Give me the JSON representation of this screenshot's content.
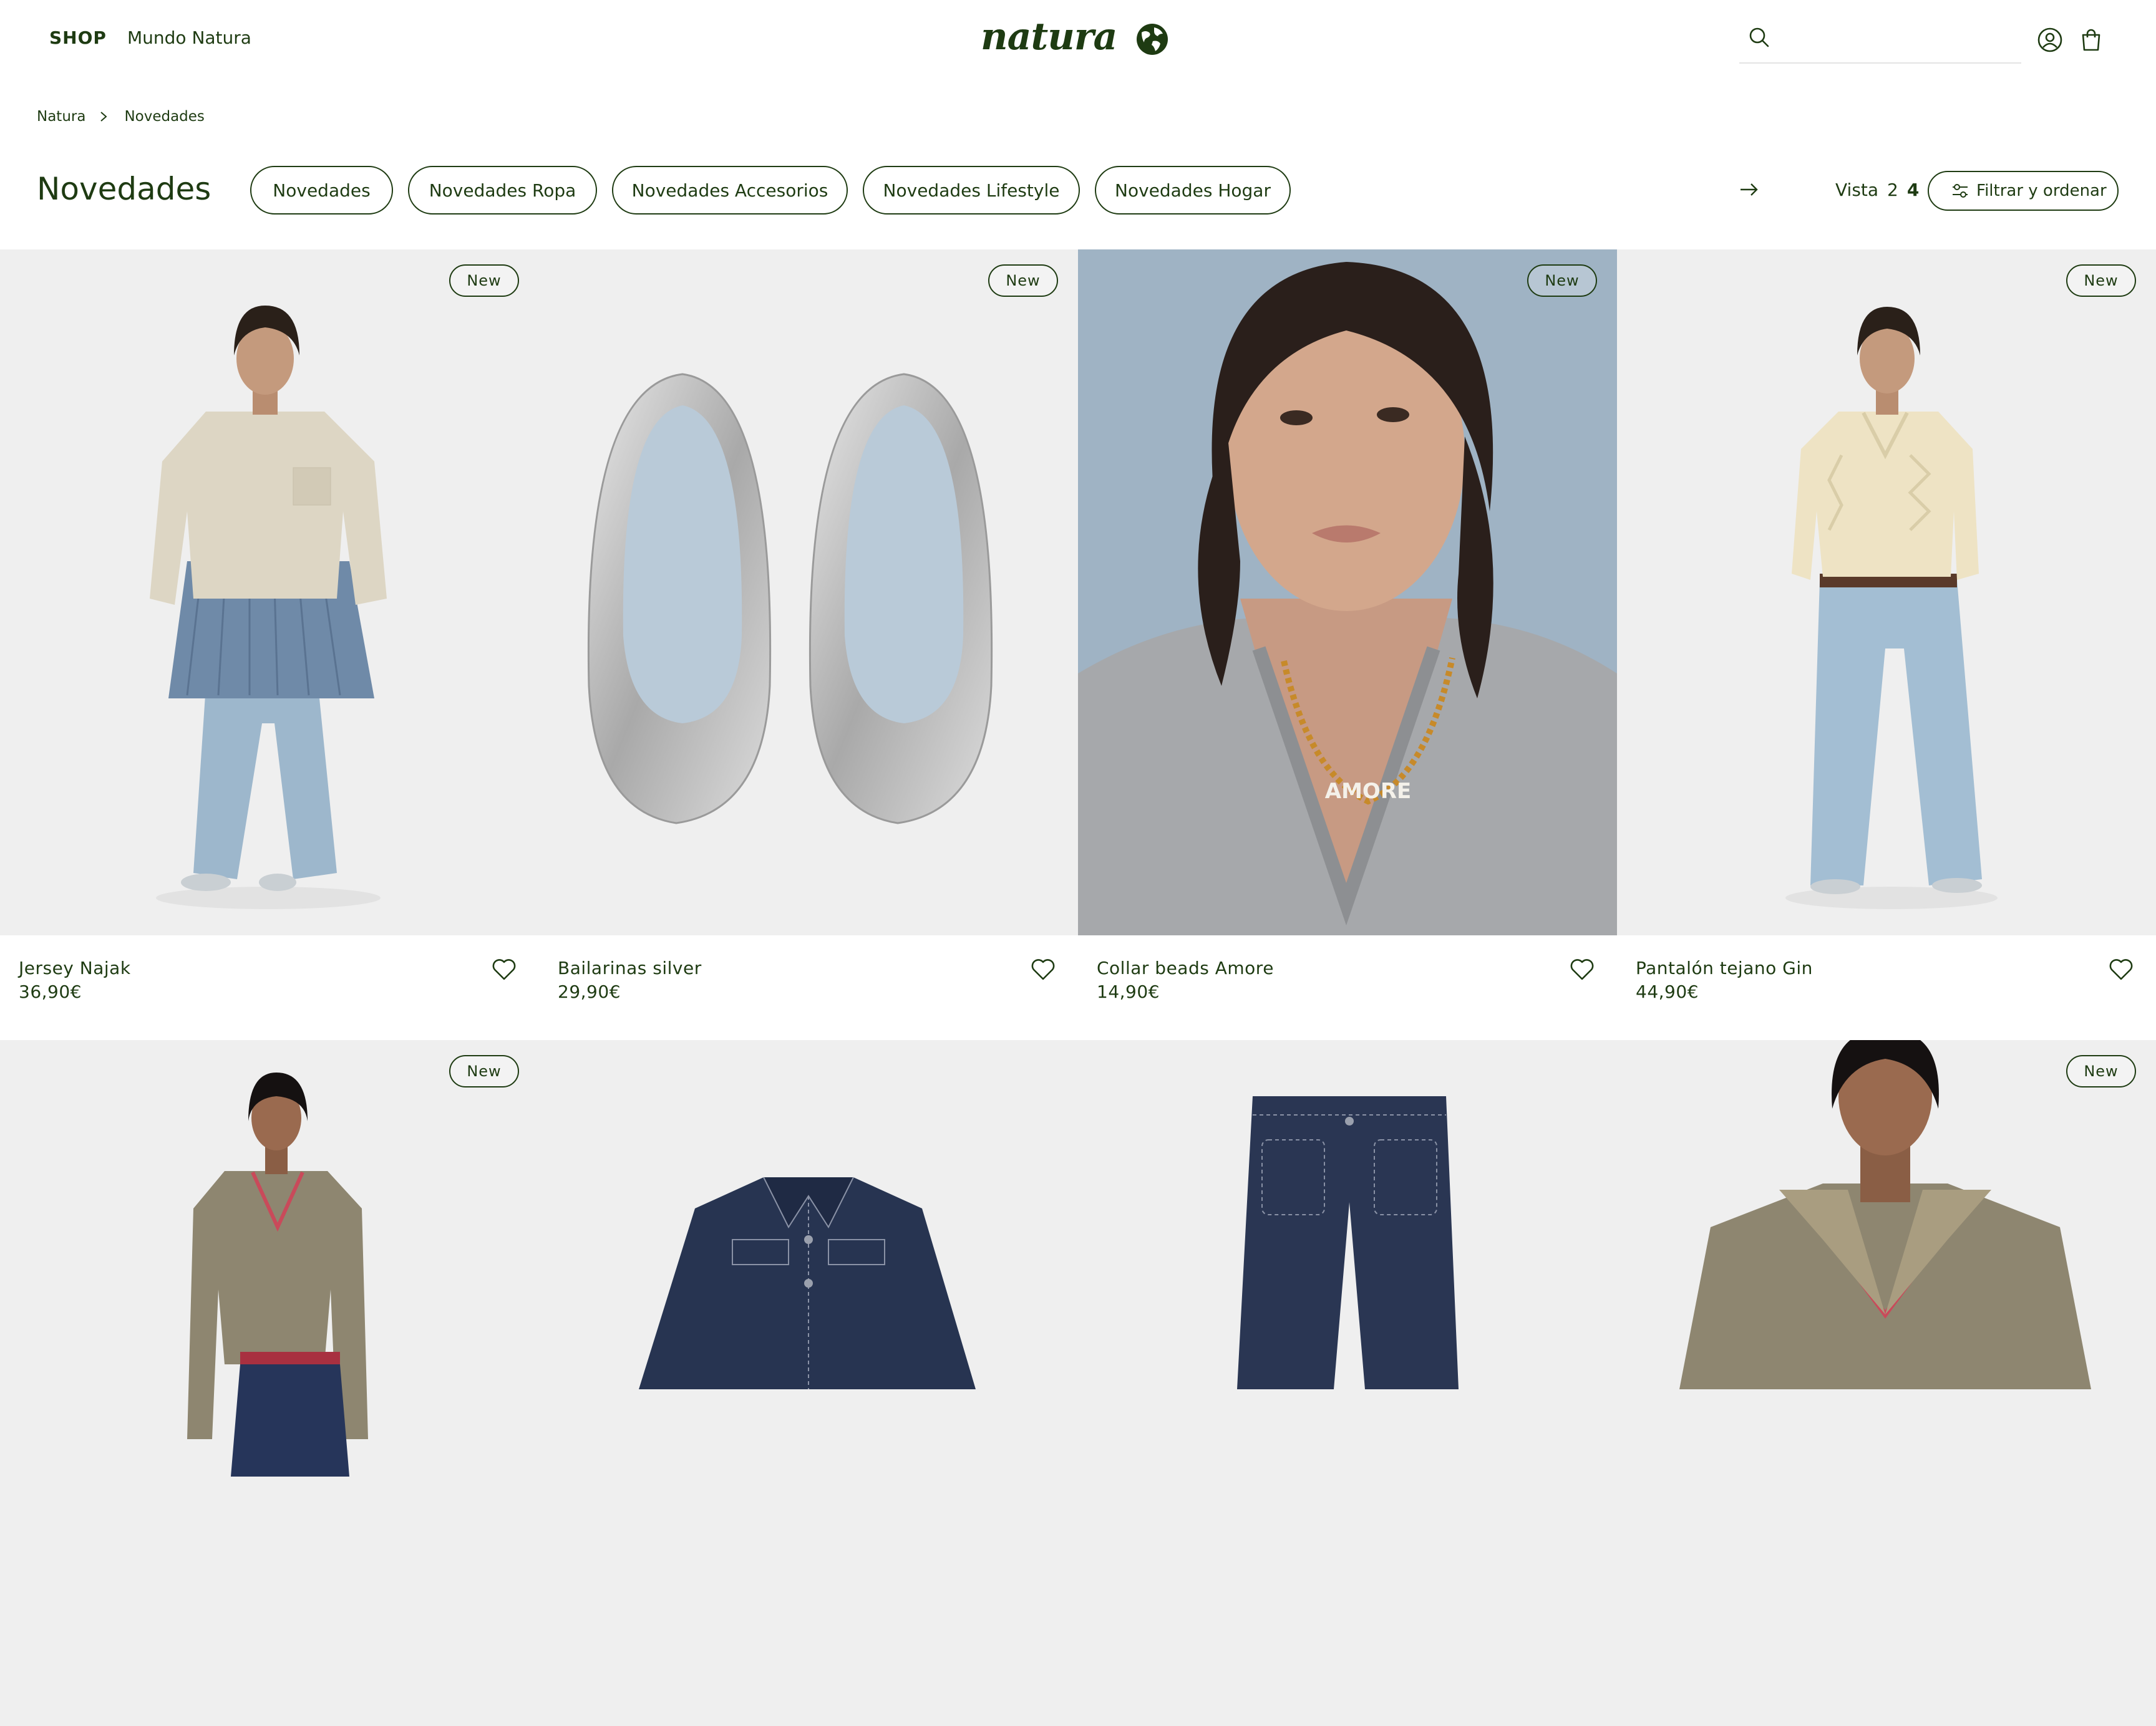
{
  "header": {
    "nav": {
      "shop": "SHOP",
      "mundo": "Mundo Natura"
    },
    "logo_text": "natura",
    "search": {
      "value": "",
      "placeholder": ""
    }
  },
  "breadcrumb": {
    "items": [
      "Natura",
      "Novedades"
    ]
  },
  "page_title": "Novedades",
  "filter_pills": [
    "Novedades",
    "Novedades Ropa",
    "Novedades Accesorios",
    "Novedades Lifestyle",
    "Novedades Hogar"
  ],
  "view": {
    "label": "Vista",
    "options": [
      "2",
      "4"
    ],
    "selected": "4"
  },
  "filter_button": "Filtrar y ordenar",
  "badge_label": "New",
  "products": [
    {
      "name": "Jersey Najak",
      "price": "36,90€",
      "is_new": true
    },
    {
      "name": "Bailarinas silver",
      "price": "29,90€",
      "is_new": true
    },
    {
      "name": "Collar beads Amore",
      "price": "14,90€",
      "is_new": true
    },
    {
      "name": "Pantalón tejano Gin",
      "price": "44,90€",
      "is_new": true
    },
    {
      "name": "",
      "price": "",
      "is_new": true
    },
    {
      "name": "",
      "price": "",
      "is_new": false
    },
    {
      "name": "",
      "price": "",
      "is_new": false
    },
    {
      "name": "",
      "price": "",
      "is_new": true
    }
  ],
  "image_text": {
    "necklace": "AMORE"
  },
  "colors": {
    "brand_green": "#1e3b12",
    "image_background": "#efefef",
    "portrait_background": "#9fb3c4"
  }
}
